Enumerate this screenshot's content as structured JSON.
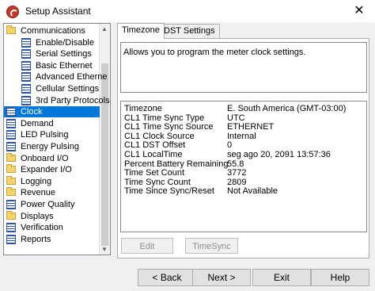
{
  "window": {
    "title": "Setup Assistant",
    "close_glyph": "✕"
  },
  "tree": {
    "items": [
      {
        "label": "Communications",
        "icon": "folder-icon",
        "indent": 0
      },
      {
        "label": "Enable/Disable",
        "icon": "grid-icon",
        "indent": 1
      },
      {
        "label": "Serial Settings",
        "icon": "grid-icon",
        "indent": 1
      },
      {
        "label": "Basic Ethernet",
        "icon": "grid-icon",
        "indent": 1
      },
      {
        "label": "Advanced Etherne",
        "icon": "grid-icon",
        "indent": 1
      },
      {
        "label": "Cellular Settings",
        "icon": "grid-icon",
        "indent": 1
      },
      {
        "label": "3rd Party Protocols",
        "icon": "grid-icon",
        "indent": 1
      },
      {
        "label": "Clock",
        "icon": "grid-icon",
        "indent": 0,
        "selected": true
      },
      {
        "label": "Demand",
        "icon": "grid-icon",
        "indent": 0
      },
      {
        "label": "LED Pulsing",
        "icon": "grid-icon",
        "indent": 0
      },
      {
        "label": "Energy Pulsing",
        "icon": "grid-icon",
        "indent": 0
      },
      {
        "label": "Onboard I/O",
        "icon": "folder-icon",
        "indent": 0
      },
      {
        "label": "Expander I/O",
        "icon": "folder-icon",
        "indent": 0
      },
      {
        "label": "Logging",
        "icon": "folder-icon",
        "indent": 0
      },
      {
        "label": "Revenue",
        "icon": "folder-icon",
        "indent": 0
      },
      {
        "label": "Power Quality",
        "icon": "grid-icon",
        "indent": 0
      },
      {
        "label": "Displays",
        "icon": "folder-icon",
        "indent": 0
      },
      {
        "label": "Verification",
        "icon": "grid-icon",
        "indent": 0
      },
      {
        "label": "Reports",
        "icon": "grid-icon",
        "indent": 0
      }
    ]
  },
  "tabs": [
    {
      "label": "Timezone",
      "active": true
    },
    {
      "label": "DST Settings",
      "active": false
    }
  ],
  "panel": {
    "description": "Allows you to program the meter clock settings.",
    "rows": [
      {
        "key": "Timezone",
        "value": "E. South America (GMT-03:00)"
      },
      {
        "key": "CL1 Time Sync Type",
        "value": "UTC"
      },
      {
        "key": "CL1 Time Sync Source",
        "value": "ETHERNET"
      },
      {
        "key": "CL1 Clock Source",
        "value": "Internal"
      },
      {
        "key": "CL1 DST Offset",
        "value": "0"
      },
      {
        "key": "CL1 LocalTime",
        "value": "seg ago 20, 2091 13:57:36"
      },
      {
        "key": "Percent Battery Remaining",
        "value": "55.8"
      },
      {
        "key": "Time Set Count",
        "value": "3772"
      },
      {
        "key": "Time Sync Count",
        "value": "2809"
      },
      {
        "key": "Time Since Sync/Reset",
        "value": "Not Available"
      }
    ],
    "edit_label": "Edit",
    "timesync_label": "TimeSync"
  },
  "footer": {
    "back_label": "< Back",
    "next_label": "Next >",
    "exit_label": "Exit",
    "help_label": "Help"
  }
}
